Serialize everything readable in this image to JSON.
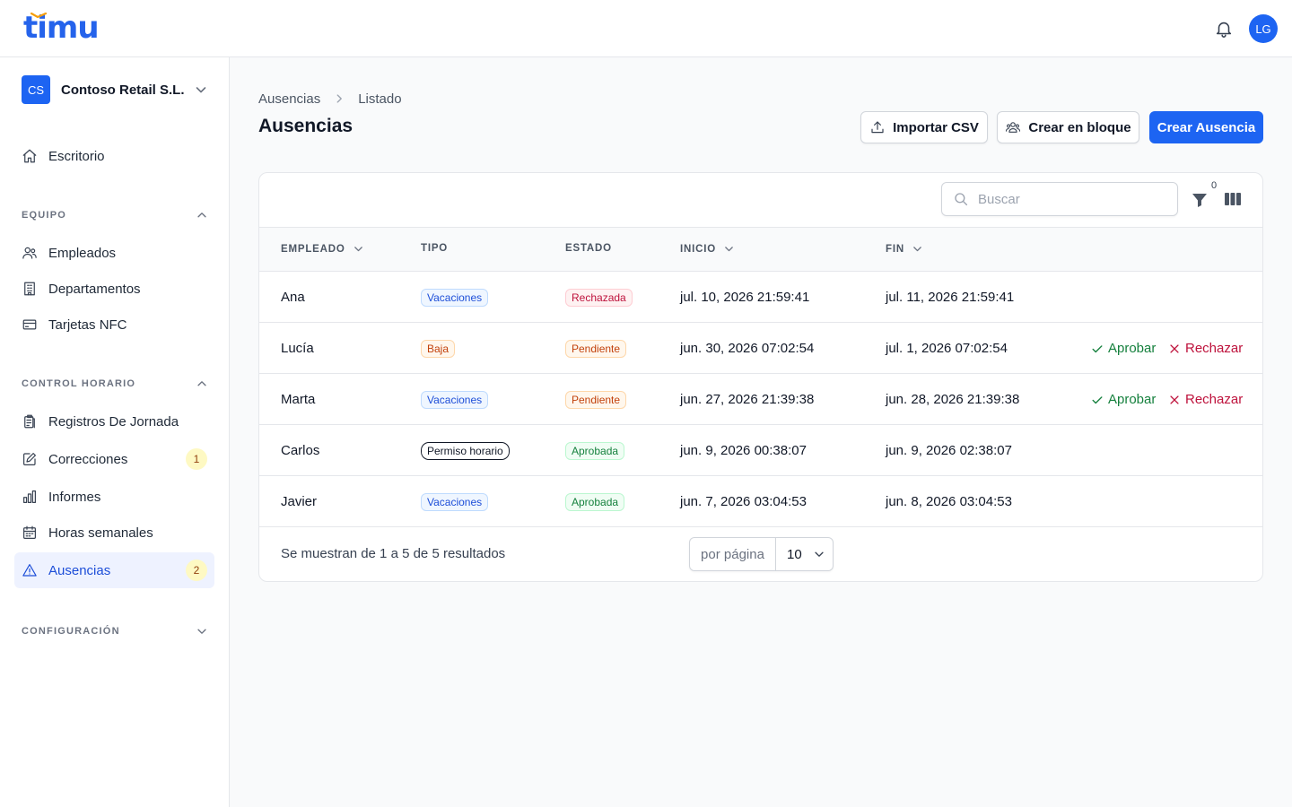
{
  "app": {
    "logo": "timu",
    "avatar_initials": "LG"
  },
  "sidebar": {
    "org": {
      "initials": "CS",
      "name": "Contoso Retail S.L."
    },
    "dashboard": "Escritorio",
    "sections": [
      {
        "label": "EQUIPO",
        "items": [
          "Empleados",
          "Departamentos",
          "Tarjetas NFC"
        ]
      },
      {
        "label": "CONTROL HORARIO",
        "items": [
          "Registros De Jornada",
          "Correcciones",
          "Informes",
          "Horas semanales",
          "Ausencias"
        ]
      },
      {
        "label": "CONFIGURACIÓN",
        "items": []
      }
    ],
    "badges": {
      "correcciones": "1",
      "ausencias": "2"
    }
  },
  "breadcrumb": [
    "Ausencias",
    "Listado"
  ],
  "page_title": "Ausencias",
  "actions": {
    "import": "Importar CSV",
    "bulk": "Crear en bloque",
    "create": "Crear Ausencia"
  },
  "search": {
    "placeholder": "Buscar",
    "filter_count": "0"
  },
  "table": {
    "headers": [
      "EMPLEADO",
      "TIPO",
      "ESTADO",
      "INICIO",
      "FIN"
    ],
    "approve_label": "Aprobar",
    "reject_label": "Rechazar",
    "rows": [
      {
        "empleado": "Ana",
        "tipo": "Vacaciones",
        "estado": "Rechazada",
        "inicio": "jul. 10, 2026 21:59:41",
        "fin": "jul. 11, 2026 21:59:41"
      },
      {
        "empleado": "Lucía",
        "tipo": "Baja",
        "estado": "Pendiente",
        "inicio": "jun. 30, 2026 07:02:54",
        "fin": "jul. 1, 2026 07:02:54"
      },
      {
        "empleado": "Marta",
        "tipo": "Vacaciones",
        "estado": "Pendiente",
        "inicio": "jun. 27, 2026 21:39:38",
        "fin": "jun. 28, 2026 21:39:38"
      },
      {
        "empleado": "Carlos",
        "tipo": "Permiso horario",
        "estado": "Aprobada",
        "inicio": "jun. 9, 2026 00:38:07",
        "fin": "jun. 9, 2026 02:38:07"
      },
      {
        "empleado": "Javier",
        "tipo": "Vacaciones",
        "estado": "Aprobada",
        "inicio": "jun. 7, 2026 03:04:53",
        "fin": "jun. 8, 2026 03:04:53"
      }
    ]
  },
  "footer": {
    "summary": "Se muestran de 1 a 5 de 5 resultados",
    "per_page_label": "por página",
    "per_page_value": "10"
  },
  "colors": {
    "primary": "#1d64f2"
  }
}
